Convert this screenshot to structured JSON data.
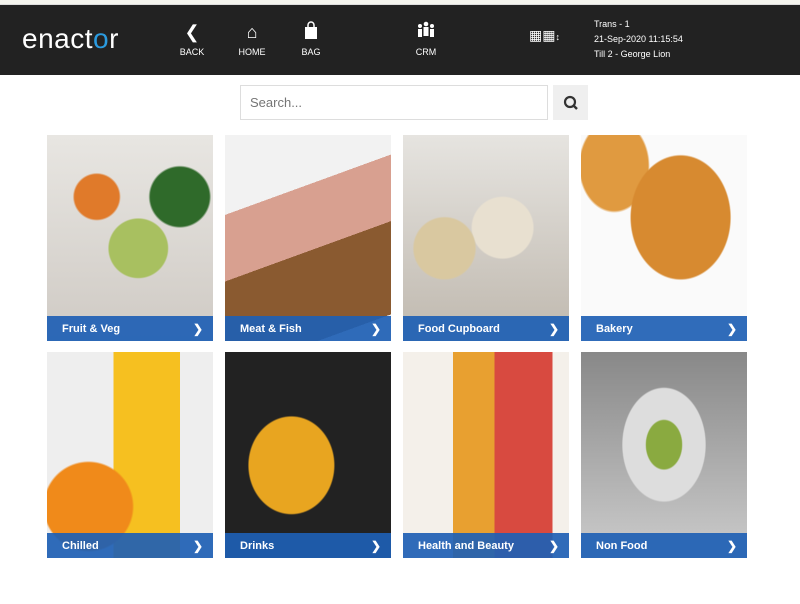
{
  "header": {
    "logo": "enactor",
    "nav": [
      {
        "label": "BACK",
        "icon": "chevron-left-icon"
      },
      {
        "label": "HOME",
        "icon": "home-icon"
      },
      {
        "label": "BAG",
        "icon": "bag-icon"
      },
      {
        "label": "CRM",
        "icon": "people-icon"
      }
    ],
    "keyboard_icon": "keyboard-icon",
    "info": {
      "trans": "Trans - 1",
      "datetime": "21-Sep-2020 11:15:54",
      "till": "Till 2 - George Lion"
    }
  },
  "search": {
    "placeholder": "Search...",
    "value": ""
  },
  "categories": [
    {
      "label": "Fruit & Veg"
    },
    {
      "label": "Meat & Fish"
    },
    {
      "label": "Food Cupboard"
    },
    {
      "label": "Bakery"
    },
    {
      "label": "Chilled"
    },
    {
      "label": "Drinks"
    },
    {
      "label": "Health and Beauty"
    },
    {
      "label": "Non Food"
    }
  ],
  "colors": {
    "header": "#222222",
    "accent": "#1f5fb4",
    "logo_accent": "#2b9be0"
  }
}
